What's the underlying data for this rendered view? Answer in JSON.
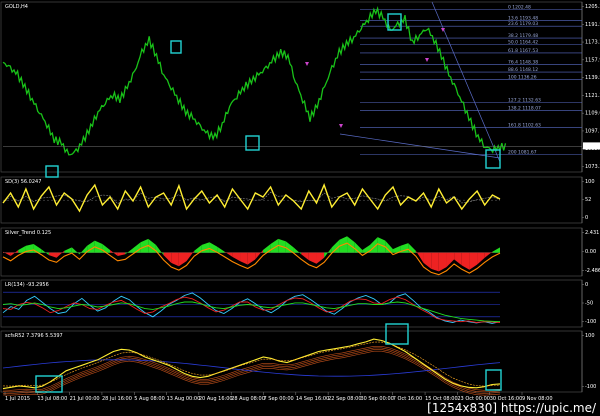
{
  "watermark": "[1254x830]  https://upic.me/",
  "colors": {
    "price": "#19c219",
    "fib": "#5a6cc8",
    "box": "#22d3d3",
    "yellow": "#ffee33",
    "green": "#22dd22",
    "red": "#ee2222",
    "orange": "#ff8800",
    "blue": "#2a3cd8",
    "cyan": "#33ccff",
    "magenta": "#cc44cc"
  },
  "chart_data": [
    {
      "type": "line",
      "title": "GOLD,H4",
      "ylim": [
        1073.3,
        1205.3
      ],
      "y_ticks": [
        "1205.3",
        "1191.5",
        "1173.2",
        "1157.9",
        "1139.5",
        "1121.3",
        "1109.0",
        "1097.1",
        "1085.2",
        "1073.3"
      ],
      "current_price_label": "1092.3",
      "fib_levels": [
        {
          "label": "0 1202.48",
          "value": 1202.48
        },
        {
          "label": "13.6 1193.48",
          "value": 1193.48
        },
        {
          "label": "23.6 1179.03",
          "value": 1189.03
        },
        {
          "label": "38.2 1179.48",
          "value": 1179.48
        },
        {
          "label": "50.0 1164.42",
          "value": 1174.42
        },
        {
          "label": "61.8 1167.53",
          "value": 1167.53
        },
        {
          "label": "76.4 1148.38",
          "value": 1158.38
        },
        {
          "label": "88.6 1148.12",
          "value": 1152.12
        },
        {
          "label": "100 1136.26",
          "value": 1146.26
        },
        {
          "label": "127.2 1132.63",
          "value": 1127.63
        },
        {
          "label": "138.2 1118.07",
          "value": 1121.07
        },
        {
          "label": "161.8 1102.63",
          "value": 1107.63
        },
        {
          "label": "200 1081.67",
          "value": 1085.67
        }
      ],
      "series": [
        {
          "values": [
            1160,
            1155,
            1150,
            1140,
            1130,
            1120,
            1110,
            1098,
            1095,
            1085,
            1088,
            1097,
            1108,
            1120,
            1128,
            1134,
            1130,
            1140,
            1152,
            1168,
            1178,
            1165,
            1150,
            1140,
            1130,
            1120,
            1115,
            1108,
            1102,
            1100,
            1110,
            1125,
            1133,
            1140,
            1145,
            1150,
            1155,
            1162,
            1168,
            1165,
            1145,
            1130,
            1115,
            1125,
            1140,
            1155,
            1168,
            1175,
            1180,
            1188,
            1195,
            1202,
            1196,
            1185,
            1190,
            1195,
            1176,
            1182,
            1188,
            1178,
            1165,
            1150,
            1138,
            1125,
            1112,
            1100,
            1092,
            1090,
            1092
          ]
        }
      ]
    },
    {
      "type": "line",
      "title": "SD(3) 56.0247",
      "ylim": [
        0,
        100
      ],
      "y_ticks": [
        "100",
        "52",
        "0"
      ],
      "series": [
        {
          "values": [
            45,
            70,
            35,
            80,
            30,
            62,
            85,
            40,
            70,
            55,
            25,
            65,
            90,
            40,
            60,
            30,
            75,
            50,
            85,
            35,
            60,
            70,
            40,
            88,
            30,
            55,
            75,
            45,
            65,
            35,
            80,
            55,
            30,
            70,
            60,
            85,
            40,
            65,
            50,
            30,
            75,
            45,
            90,
            35,
            60,
            70,
            40,
            80,
            55,
            30,
            65,
            85,
            40,
            60,
            50,
            70,
            35,
            80,
            45,
            60,
            30,
            55,
            75,
            40,
            65,
            55
          ]
        }
      ]
    },
    {
      "type": "area",
      "title": "Silver_Trend 0.125",
      "ylim": [
        -2.5,
        2.4
      ],
      "y_ticks": [
        "2.431",
        "0.00",
        "-2.486"
      ],
      "series": [
        {
          "values": [
            0.1,
            -0.4,
            0.3,
            0.8,
            1.0,
            0.4,
            -0.3,
            -0.6,
            0.2,
            0.6,
            -0.2,
            0.8,
            1.4,
            1.0,
            0.3,
            -0.4,
            -0.2,
            0.5,
            1.2,
            1.6,
            0.9,
            -0.3,
            -1.2,
            -1.6,
            -1.0,
            0.2,
            0.9,
            1.2,
            0.7,
            0.1,
            -0.5,
            -1.0,
            -1.4,
            -0.8,
            0.3,
            1.0,
            1.6,
            1.3,
            0.6,
            -0.2,
            -0.9,
            -1.3,
            -0.6,
            0.6,
            1.5,
            1.9,
            1.2,
            0.3,
            0.9,
            1.8,
            1.4,
            0.4,
            0.8,
            1.1,
            0.2,
            -1.2,
            -1.9,
            -2.2,
            -1.7,
            -0.8,
            -1.5,
            -2.0,
            -1.4,
            -0.6,
            0.1,
            0.6
          ]
        }
      ]
    },
    {
      "type": "line",
      "title": "LR(134) -93.2956",
      "ylim": [
        -100,
        0
      ],
      "y_ticks": [
        "0",
        "-50",
        "-100"
      ],
      "series": [
        {
          "values": [
            -70,
            -55,
            -62,
            -40,
            -30,
            -45,
            -60,
            -72,
            -68,
            -48,
            -35,
            -52,
            -66,
            -58,
            -42,
            -30,
            -38,
            -55,
            -70,
            -80,
            -66,
            -50,
            -40,
            -28,
            -22,
            -34,
            -50,
            -65,
            -72,
            -60,
            -45,
            -36,
            -48,
            -62,
            -70,
            -58,
            -40,
            -30,
            -26,
            -38,
            -52,
            -66,
            -74,
            -60,
            -44,
            -34,
            -28,
            -36,
            -50,
            -46,
            -30,
            -24,
            -40,
            -58,
            -68,
            -82,
            -90,
            -94,
            -88,
            -92,
            -95,
            -92,
            -96,
            -92
          ]
        },
        {
          "values": [
            -60,
            -62,
            -50,
            -45,
            -48,
            -58,
            -70,
            -65,
            -55,
            -46,
            -50,
            -60,
            -62,
            -52,
            -44,
            -40,
            -50,
            -62,
            -72,
            -68,
            -56,
            -48,
            -38,
            -32,
            -36,
            -46,
            -58,
            -68,
            -64,
            -54,
            -44,
            -44,
            -56,
            -64,
            -62,
            -50,
            -40,
            -34,
            -36,
            -46,
            -58,
            -68,
            -66,
            -54,
            -42,
            -36,
            -38,
            -46,
            -48,
            -38,
            -32,
            -38,
            -50,
            -62,
            -72,
            -84,
            -88,
            -90,
            -92,
            -90,
            -94,
            -92,
            -93,
            -94
          ]
        },
        {
          "values": [
            -50,
            -48,
            -52,
            -50,
            -46,
            -50,
            -56,
            -60,
            -58,
            -54,
            -50,
            -52,
            -56,
            -54,
            -50,
            -46,
            -48,
            -54,
            -60,
            -62,
            -58,
            -54,
            -48,
            -44,
            -44,
            -48,
            -54,
            -58,
            -60,
            -56,
            -52,
            -50,
            -52,
            -56,
            -58,
            -54,
            -50,
            -46,
            -46,
            -50,
            -54,
            -58,
            -60,
            -56,
            -52,
            -48,
            -48,
            -50,
            -50,
            -46,
            -44,
            -46,
            -52,
            -58,
            -64,
            -70,
            -76,
            -80,
            -84,
            -86,
            -88,
            -90,
            -91,
            -92
          ]
        }
      ]
    },
    {
      "type": "line",
      "title": "scfsR52 7.3796 5.5397",
      "ylim": [
        -100,
        100
      ],
      "y_ticks": [
        "100",
        "-100"
      ],
      "series": [
        {
          "values": [
            -95,
            -90,
            -85,
            -88,
            -92,
            -86,
            -70,
            -50,
            -30,
            -20,
            -10,
            0,
            10,
            25,
            40,
            48,
            45,
            35,
            20,
            10,
            0,
            -10,
            -25,
            -40,
            -50,
            -55,
            -50,
            -40,
            -30,
            -20,
            -10,
            0,
            10,
            20,
            15,
            5,
            0,
            10,
            20,
            30,
            40,
            45,
            50,
            55,
            60,
            68,
            75,
            85,
            80,
            70,
            55,
            40,
            20,
            0,
            -20,
            -40,
            -60,
            -75,
            -85,
            -90,
            -92,
            -88,
            -80,
            -78
          ]
        },
        {
          "values": [
            -85,
            -86,
            -84,
            -82,
            -84,
            -82,
            -72,
            -58,
            -44,
            -32,
            -20,
            -10,
            0,
            12,
            24,
            34,
            38,
            34,
            26,
            16,
            6,
            -6,
            -18,
            -30,
            -40,
            -46,
            -46,
            -40,
            -32,
            -22,
            -12,
            -4,
            4,
            12,
            12,
            8,
            6,
            10,
            18,
            26,
            34,
            40,
            46,
            50,
            56,
            62,
            68,
            74,
            74,
            68,
            58,
            46,
            32,
            16,
            -2,
            -20,
            -40,
            -56,
            -68,
            -78,
            -84,
            -86,
            -84,
            -82
          ]
        }
      ]
    }
  ],
  "x_labels": [
    "1 Jul 2015",
    "13 Jul 08:00",
    "21 Jul 00:00",
    "28 Jul 16:00",
    "5 Aug 08:00",
    "13 Aug 00:00",
    "20 Aug 16:00",
    "28 Aug 08:00",
    "7 Sep 00:00",
    "14 Sep 16:00",
    "22 Sep 08:00",
    "30 Sep 00:00",
    "7 Oct 16:00",
    "15 Oct 08:00",
    "23 Oct 00:00",
    "30 Oct 16:00",
    "9 Nov 08:00"
  ]
}
